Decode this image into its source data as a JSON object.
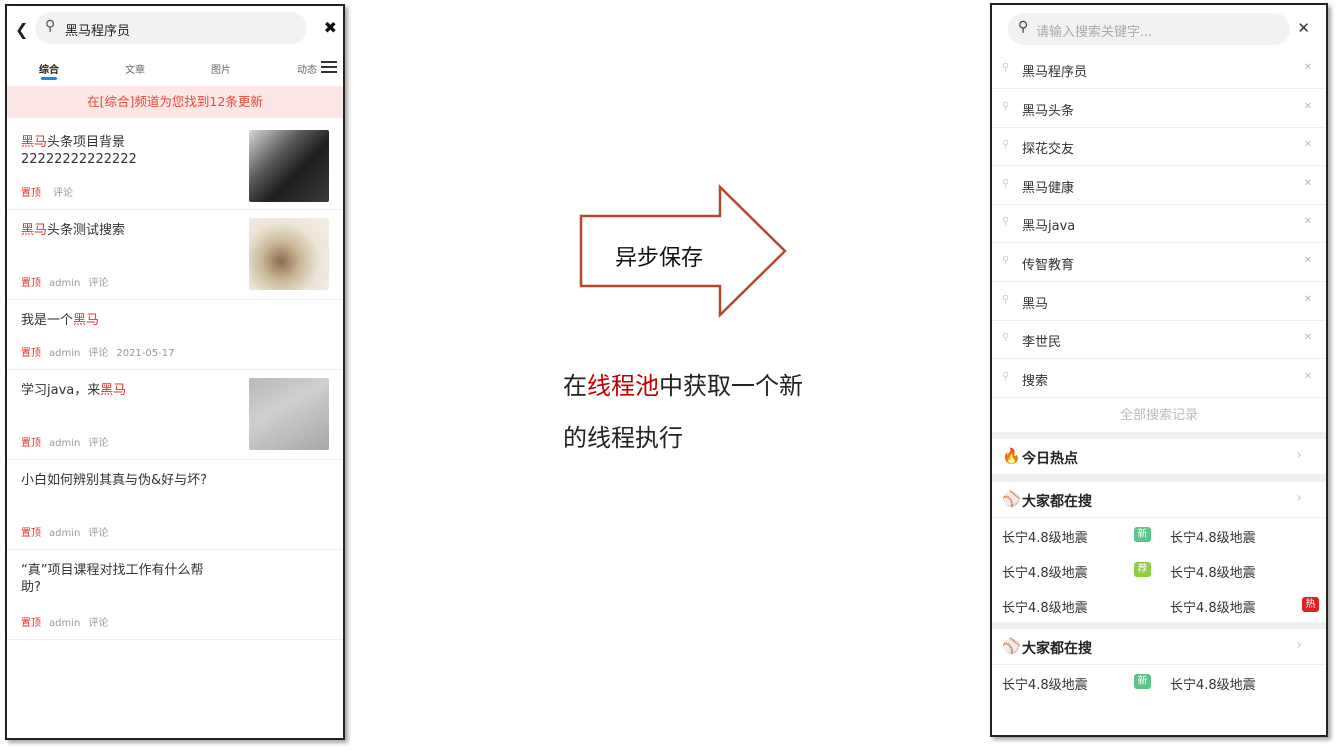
{
  "left": {
    "back_icon": "chevron-left-icon",
    "search_value": "黑马程序员",
    "tabs": [
      "综合",
      "文章",
      "图片",
      "动态"
    ],
    "notice": "在[综合]频道为您找到12条更新",
    "items": [
      {
        "title_hl": "黑马",
        "title_rest": "头条项目背景 22222222222222",
        "top": "置顶",
        "author": "",
        "comment": "评论",
        "date": ""
      },
      {
        "title_hl": "黑马",
        "title_rest": "头条测试搜索",
        "top": "置顶",
        "author": "admin",
        "comment": "评论",
        "date": ""
      },
      {
        "title_pre": "我是一个",
        "title_hl": "黑马",
        "top": "置顶",
        "author": "admin",
        "comment": "评论",
        "date": "2021-05-17"
      },
      {
        "title_pre": "学习java，来",
        "title_hl": "黑马",
        "top": "置顶",
        "author": "admin",
        "comment": "评论",
        "date": ""
      },
      {
        "title_pre": "小白如何辨别其真与伪&好与坏?",
        "top": "置顶",
        "author": "admin",
        "comment": "评论",
        "date": ""
      },
      {
        "title_pre": "“真”项目课程对找工作有什么帮助?",
        "top": "置顶",
        "author": "admin",
        "comment": "评论",
        "date": ""
      }
    ]
  },
  "middle": {
    "arrow_label": "异步保存",
    "desc_pre": "在",
    "desc_hl": "线程池",
    "desc_post": "中获取一个新的线程执行",
    "arrow_color": "#b5492e"
  },
  "right": {
    "search_placeholder": "请输入搜索关键字...",
    "history": [
      "黑马程序员",
      "黑马头条",
      "探花交友",
      "黑马健康",
      "黑马java",
      "传智教育",
      "黑马",
      "李世民",
      "搜索"
    ],
    "all_history": "全部搜索记录",
    "today_hot": "今日热点",
    "everyone_search": "大家都在搜",
    "hot_text": "长宁4.8级地震",
    "badges": {
      "new": "新",
      "rec": "荐",
      "hot": "热"
    },
    "colors": {
      "new": "#5cc38a",
      "rec": "#8ccf3f",
      "hot": "#e02020"
    }
  }
}
